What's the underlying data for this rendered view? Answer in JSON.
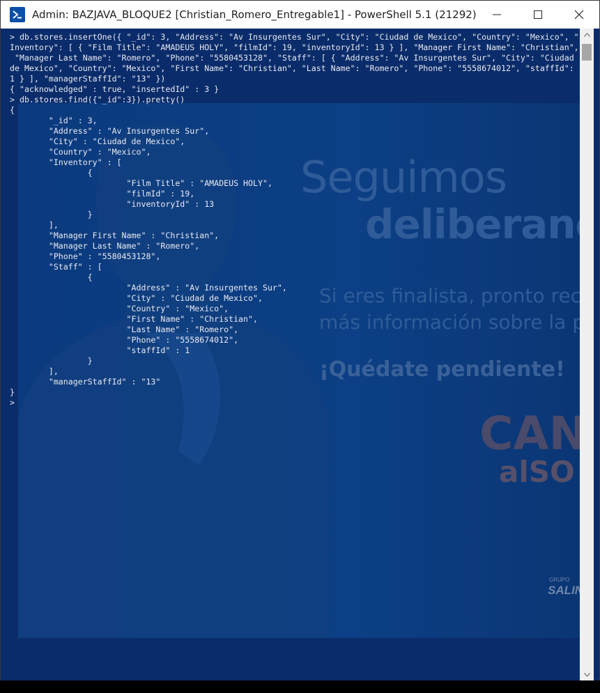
{
  "window": {
    "title": "Admin: BAZJAVA_BLOQUE2 [Christian_Romero_Entregable1] - PowerShell 5.1 (21292)",
    "app_icon": "powershell-icon",
    "controls": [
      "minimize-icon",
      "maximize-icon",
      "close-icon"
    ]
  },
  "console": {
    "lines": [
      "> db.stores.insertOne({ \"_id\": 3, \"Address\": \"Av Insurgentes Sur\", \"City\": \"Ciudad de Mexico\", \"Country\": \"Mexico\", \"",
      "Inventory\": [ { \"Film Title\": \"AMADEUS HOLY\", \"filmId\": 19, \"inventoryId\": 13 } ], \"Manager First Name\": \"Christian\",",
      " \"Manager Last Name\": \"Romero\", \"Phone\": \"5580453128\", \"Staff\": [ { \"Address\": \"Av Insurgentes Sur\", \"City\": \"Ciudad",
      "de Mexico\", \"Country\": \"Mexico\", \"First Name\": \"Christian\", \"Last Name\": \"Romero\", \"Phone\": \"5558674012\", \"staffId\":",
      "1 } ], \"managerStaffId\": \"13\" })",
      "{ \"acknowledged\" : true, \"insertedId\" : 3 }",
      "> db.stores.find({\"_id\":3}).pretty()",
      "{",
      "        \"_id\" : 3,",
      "        \"Address\" : \"Av Insurgentes Sur\",",
      "        \"City\" : \"Ciudad de Mexico\",",
      "        \"Country\" : \"Mexico\",",
      "        \"Inventory\" : [",
      "                {",
      "                        \"Film Title\" : \"AMADEUS HOLY\",",
      "                        \"filmId\" : 19,",
      "                        \"inventoryId\" : 13",
      "                }",
      "        ],",
      "        \"Manager First Name\" : \"Christian\",",
      "        \"Manager Last Name\" : \"Romero\",",
      "        \"Phone\" : \"5580453128\",",
      "        \"Staff\" : [",
      "                {",
      "                        \"Address\" : \"Av Insurgentes Sur\",",
      "                        \"City\" : \"Ciudad de Mexico\",",
      "                        \"Country\" : \"Mexico\",",
      "                        \"First Name\" : \"Christian\",",
      "                        \"Last Name\" : \"Romero\",",
      "                        \"Phone\" : \"5558674012\",",
      "                        \"staffId\" : 1",
      "                }",
      "        ],",
      "        \"managerStaffId\" : \"13\"",
      "}",
      ">"
    ]
  },
  "background": {
    "headline_1": "Seguimos",
    "headline_2": "deliberanc",
    "paragraph_1": "Si eres finalista, pronto recibir",
    "paragraph_2": "más información sobre la pre",
    "cta": "¡Quédate pendiente!",
    "logo_line_1": "CAN",
    "logo_line_2": "alSO",
    "brand_small": "GRUPO",
    "brand": "SALINAS",
    "colors": {
      "terminal_bg": "#0a2c6b",
      "text": "#e8eaf0",
      "overlay_text": "#2f5c98"
    }
  }
}
